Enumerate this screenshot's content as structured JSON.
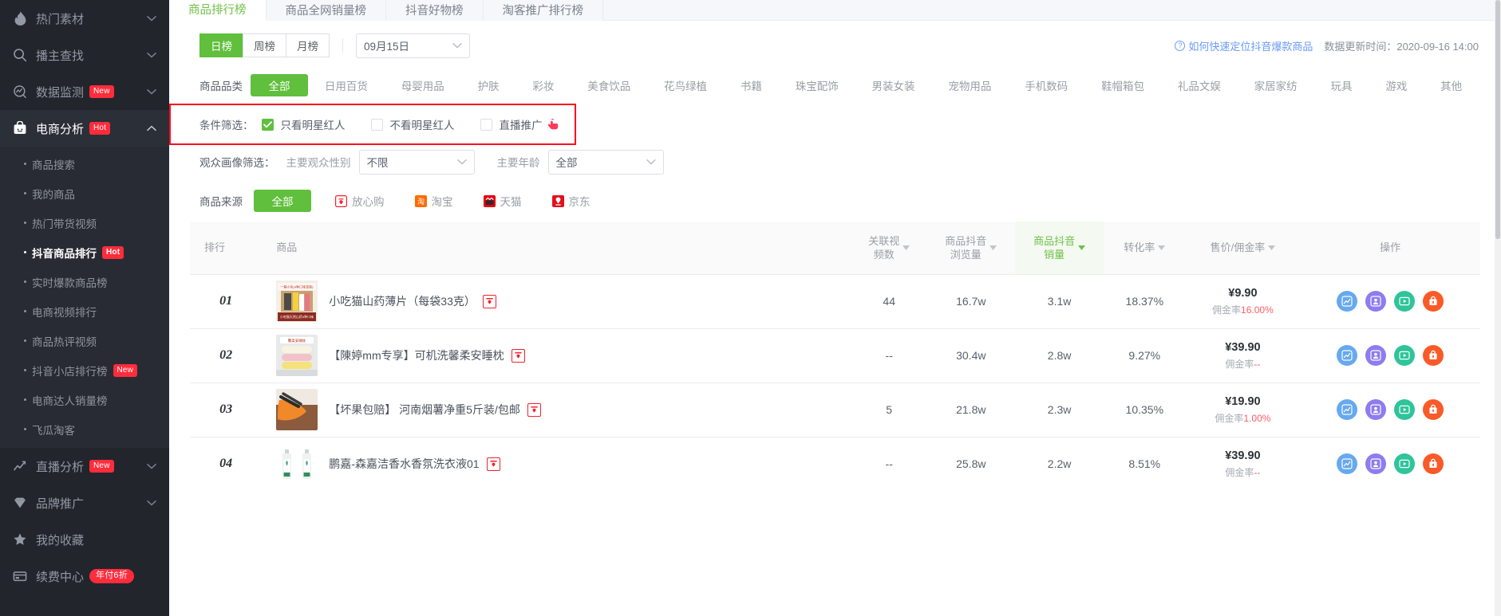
{
  "sidebar": {
    "groups": [
      {
        "label": "热门素材",
        "icon": "fire-icon",
        "badge": null,
        "active": false,
        "expanded": false
      },
      {
        "label": "播主查找",
        "icon": "search-icon",
        "badge": null,
        "active": false,
        "expanded": false
      },
      {
        "label": "数据监测",
        "icon": "monitor-icon",
        "badge": "New",
        "active": false,
        "expanded": false
      },
      {
        "label": "电商分析",
        "icon": "shop-bag-icon",
        "badge": "Hot",
        "active": true,
        "expanded": true
      }
    ],
    "submenu": [
      {
        "label": "商品搜索",
        "badge": null,
        "active": false
      },
      {
        "label": "我的商品",
        "badge": null,
        "active": false
      },
      {
        "label": "热门带货视频",
        "badge": null,
        "active": false
      },
      {
        "label": "抖音商品排行",
        "badge": "Hot",
        "active": true
      },
      {
        "label": "实时爆款商品榜",
        "badge": null,
        "active": false
      },
      {
        "label": "电商视频排行",
        "badge": null,
        "active": false
      },
      {
        "label": "商品热评视频",
        "badge": null,
        "active": false
      },
      {
        "label": "抖音小店排行榜",
        "badge": "New",
        "active": false
      },
      {
        "label": "电商达人销量榜",
        "badge": null,
        "active": false
      },
      {
        "label": "飞瓜淘客",
        "badge": null,
        "active": false
      }
    ],
    "bottom_groups": [
      {
        "label": "直播分析",
        "icon": "line-chart-icon",
        "badge": "New",
        "chev": true
      },
      {
        "label": "品牌推广",
        "icon": "diamond-icon",
        "badge": null,
        "chev": true
      },
      {
        "label": "我的收藏",
        "icon": "star-icon",
        "badge": null,
        "chev": false
      },
      {
        "label": "续费中心",
        "icon": "card-icon",
        "badge": "年付6折",
        "chev": false
      }
    ]
  },
  "tabs": [
    {
      "label": "商品排行榜",
      "active": true
    },
    {
      "label": "商品全网销量榜",
      "active": false
    },
    {
      "label": "抖音好物榜",
      "active": false
    },
    {
      "label": "淘客推广排行榜",
      "active": false
    }
  ],
  "toolbar": {
    "period_options": [
      {
        "label": "日榜",
        "active": true
      },
      {
        "label": "周榜",
        "active": false
      },
      {
        "label": "月榜",
        "active": false
      }
    ],
    "date_value": "09月15日",
    "help_link": "如何快速定位抖音爆款商品",
    "update_time": "数据更新时间：2020-09-16 14:00"
  },
  "filters": {
    "category_label": "商品品类",
    "categories": [
      "全部",
      "日用百货",
      "母婴用品",
      "护肤",
      "彩妆",
      "美食饮品",
      "花鸟绿植",
      "书籍",
      "珠宝配饰",
      "男装女装",
      "宠物用品",
      "手机数码",
      "鞋帽箱包",
      "礼品文娱",
      "家居家纺",
      "玩具",
      "游戏",
      "其他"
    ],
    "condition_label": "条件筛选：",
    "conditions": [
      {
        "label": "只看明星红人",
        "checked": true,
        "icon": null
      },
      {
        "label": "不看明星红人",
        "checked": false,
        "icon": null
      },
      {
        "label": "直播推广",
        "checked": false,
        "icon": "hand-point-icon"
      }
    ],
    "audience_label": "观众画像筛选：",
    "gender_label": "主要观众性别",
    "gender_value": "不限",
    "age_label": "主要年龄",
    "age_value": "全部",
    "source_label": "商品来源",
    "source_all": "全部",
    "sources": [
      {
        "label": "放心购",
        "icon": "fangxin-icon",
        "color": "#ff4d4f"
      },
      {
        "label": "淘宝",
        "icon": "taobao-icon",
        "color": "#ff6a00"
      },
      {
        "label": "天猫",
        "icon": "tmall-icon",
        "color": "#e60012"
      },
      {
        "label": "京东",
        "icon": "jd-icon",
        "color": "#e3101e"
      }
    ]
  },
  "table": {
    "columns": [
      {
        "key": "rank",
        "label": "排行",
        "sortable": false,
        "highlight": false
      },
      {
        "key": "product",
        "label": "商品",
        "sortable": false,
        "highlight": false
      },
      {
        "key": "videos",
        "label": "关联视\n频数",
        "sortable": true,
        "highlight": false
      },
      {
        "key": "views",
        "label": "商品抖音\n浏览量",
        "sortable": true,
        "highlight": false
      },
      {
        "key": "sales",
        "label": "商品抖音\n销量",
        "sortable": true,
        "highlight": true
      },
      {
        "key": "conversion",
        "label": "转化率",
        "sortable": true,
        "highlight": false
      },
      {
        "key": "price",
        "label": "售价/佣金率",
        "sortable": true,
        "highlight": false
      },
      {
        "key": "actions",
        "label": "操作",
        "sortable": false,
        "highlight": false
      }
    ],
    "rows": [
      {
        "rank": "01",
        "name": "小吃猫山药薄片（每袋33克）",
        "thumb": "snack-box-photo",
        "tag": "fangxin-tag-icon",
        "videos": "44",
        "views": "16.7w",
        "sales": "3.1w",
        "conversion": "18.37%",
        "price": "¥9.90",
        "commission_label": "佣金率",
        "commission_value": "16.00%"
      },
      {
        "rank": "02",
        "name": "【陳婷mm专享】可机洗馨柔安睡枕",
        "thumb": "pillow-photo",
        "tag": "fangxin-tag-icon",
        "videos": "--",
        "views": "30.4w",
        "sales": "2.8w",
        "conversion": "9.27%",
        "price": "¥39.90",
        "commission_label": "佣金率",
        "commission_value": "--"
      },
      {
        "rank": "03",
        "name": "【坏果包赔】 河南烟薯净重5斤装/包邮",
        "thumb": "sweet-potato-photo",
        "tag": "fangxin-tag-icon",
        "videos": "5",
        "views": "21.8w",
        "sales": "2.3w",
        "conversion": "10.35%",
        "price": "¥19.90",
        "commission_label": "佣金率",
        "commission_value": "1.00%"
      },
      {
        "rank": "04",
        "name": "鹏嘉-森嘉洁香水香氛洗衣液01",
        "thumb": "detergent-photo",
        "tag": "fangxin-tag-icon",
        "videos": "--",
        "views": "25.8w",
        "sales": "2.2w",
        "conversion": "8.51%",
        "price": "¥39.90",
        "commission_label": "佣金率",
        "commission_value": "--"
      }
    ],
    "action_buttons": [
      {
        "name": "trend-chart-icon",
        "color": "#67a9ef"
      },
      {
        "name": "author-icon",
        "color": "#8e7cf0"
      },
      {
        "name": "video-play-icon",
        "color": "#2fc49a"
      },
      {
        "name": "shop-icon",
        "color": "#fa5a28"
      }
    ]
  },
  "colors": {
    "accent_green": "#60bf3c",
    "highlight_red": "#fc0d1c",
    "badge_red": "#ff2c3c",
    "link_blue": "#6b9bf5"
  }
}
